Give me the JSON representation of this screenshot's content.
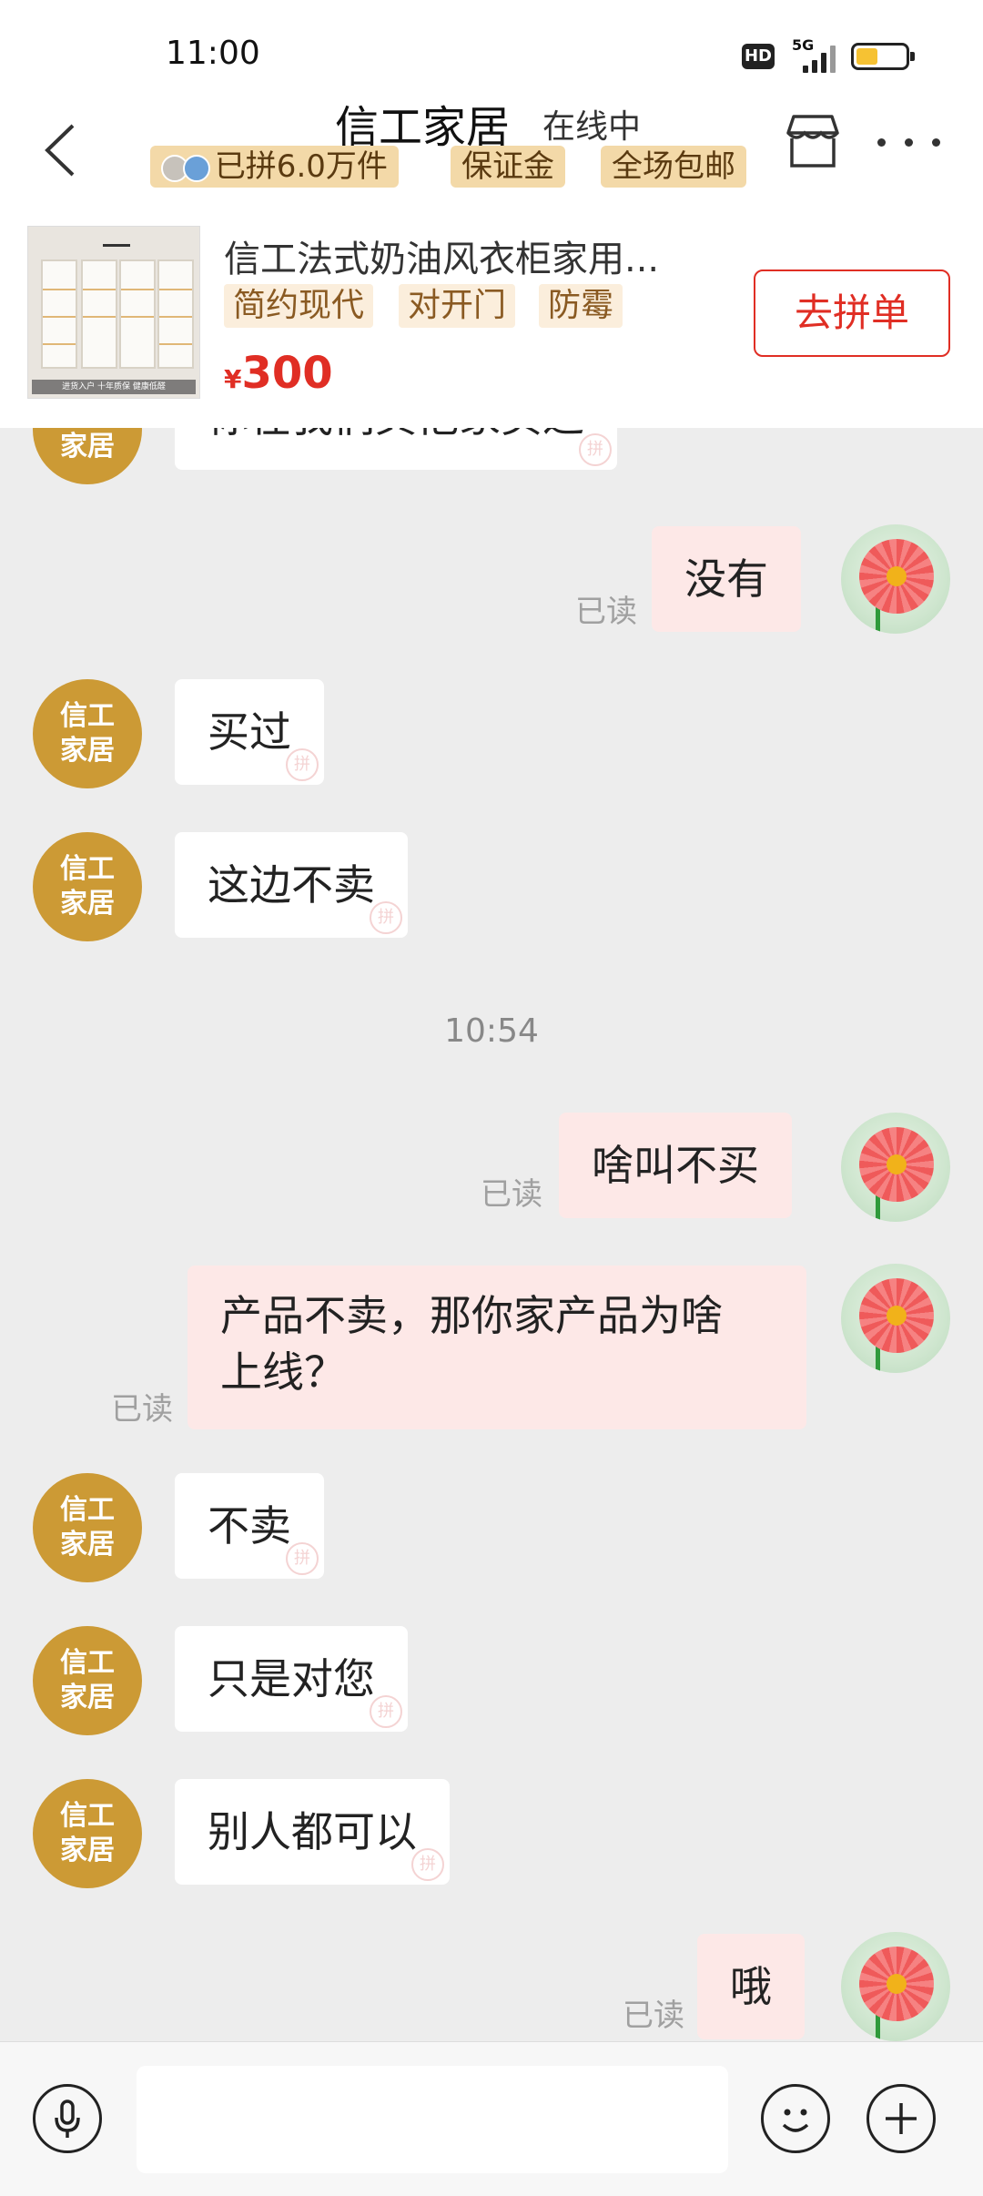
{
  "status_bar": {
    "time": "11:00",
    "hd": "HD",
    "network": "5G",
    "battery_level": 0.45
  },
  "header": {
    "title": "信工家居",
    "online_status": "在线中",
    "badges": [
      "已拼6.0万件",
      "保证金",
      "全场包邮"
    ],
    "icons": [
      "back-arrow-icon",
      "store-icon",
      "more-icon"
    ]
  },
  "product": {
    "name": "信工法式奶油风衣柜家用...",
    "tags": [
      "简约现代",
      "对开门",
      "防霉"
    ],
    "currency": "¥",
    "price": "300",
    "image_caption": "进货入户 十年质保 健康低醛",
    "button": "去拼单"
  },
  "shop_avatar": {
    "line1": "信工",
    "line2": "家居"
  },
  "read_label": "已读",
  "watermark": "拼",
  "messages": [
    {
      "from": "shop",
      "text": "你在我们其他家买过"
    },
    {
      "from": "me",
      "text": "没有",
      "read": true
    },
    {
      "from": "shop",
      "text": "买过"
    },
    {
      "from": "shop",
      "text": "这边不卖"
    },
    {
      "type": "time",
      "text": "10:54"
    },
    {
      "from": "me",
      "text": "啥叫不买",
      "read": true
    },
    {
      "from": "me",
      "text": "产品不卖，那你家产品为啥",
      "text2": "上线？",
      "read": true
    },
    {
      "from": "shop",
      "text": "不卖"
    },
    {
      "from": "shop",
      "text": "只是对您"
    },
    {
      "from": "shop",
      "text": "别人都可以"
    },
    {
      "from": "me",
      "text": "哦",
      "read": true
    }
  ],
  "bottom_bar": {
    "icons": [
      "microphone-icon",
      "emoji-icon",
      "plus-icon"
    ],
    "input_placeholder": ""
  }
}
